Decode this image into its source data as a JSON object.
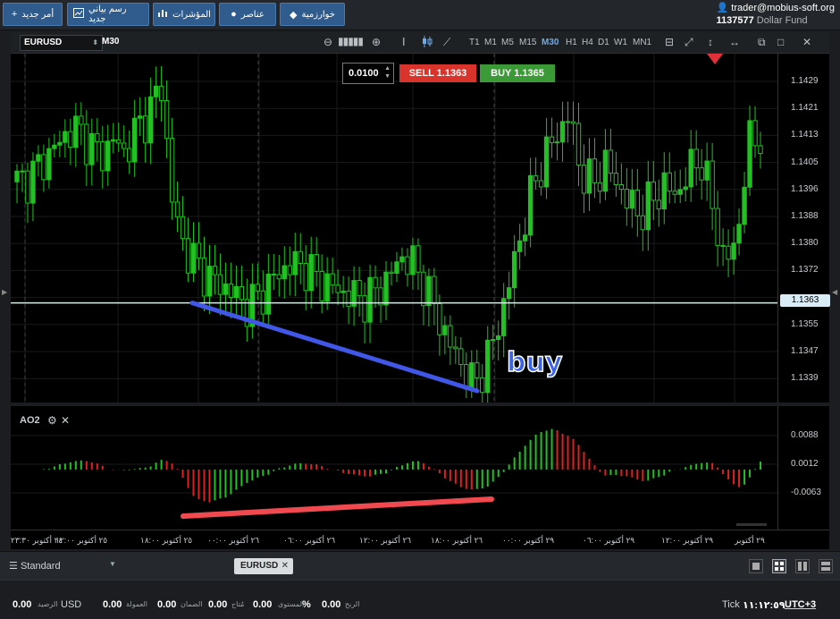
{
  "toolbar": {
    "new_order": "أمر جديد",
    "new_chart": "رسم بياني جديد",
    "indicators": "المؤشرات",
    "elements": "عناصر",
    "algorithms": "خوارزمية"
  },
  "account": {
    "user": "trader@mobius-soft.org",
    "number": "1137577",
    "fund": "Dollar Fund"
  },
  "chart_header": {
    "symbol": "EURUSD",
    "timeframe": "M30",
    "timeframes": [
      "T1",
      "M1",
      "M5",
      "M15",
      "M30",
      "H1",
      "H4",
      "D1",
      "W1",
      "MN1"
    ],
    "active_timeframe": "M30"
  },
  "order_panel": {
    "lot": "0.0100",
    "sell": "SELL 1.1363",
    "buy": "BUY 1.1365"
  },
  "annotation": {
    "buy_text": "buy"
  },
  "price_axis": {
    "labels": [
      "1.1429",
      "1.1421",
      "1.1413",
      "1.1405",
      "1.1396",
      "1.1388",
      "1.1380",
      "1.1372",
      "1.1363",
      "1.1355",
      "1.1347",
      "1.1339"
    ],
    "current_price": "1.1363"
  },
  "indicator": {
    "name": "AO2",
    "axis_labels": [
      "0.0088",
      "0.0012",
      "-0.0063"
    ]
  },
  "time_axis": {
    "labels": [
      "٢٤ أكتوبر ٢٣:٣٠",
      "٢٥ أكتوبر ١٢:٠٠",
      "٢٥ أكتوبر ١٨:٠٠",
      "٢٦ أكتوبر ٠٠:٠٠",
      "٢٦ أكتوبر ٠٦:٠٠",
      "٢٦ أكتوبر ١٢:٠٠",
      "٢٦ أكتوبر ١٨:٠٠",
      "٢٩ أكتوبر ٠٠:٠٠",
      "٢٩ أكتوبر ٠٦:٠٠",
      "٢٩ أكتوبر ١٢:٠٠",
      "٢٩ أكتوبر"
    ]
  },
  "chart_data": {
    "type": "candlestick",
    "symbol": "EURUSD",
    "timeframe": "M30",
    "price_range": [
      1.1335,
      1.1433
    ],
    "close_series": [
      1.1397,
      1.1398,
      1.1402,
      1.1406,
      1.141,
      1.1412,
      1.1408,
      1.1404,
      1.1409,
      1.1405,
      1.1412,
      1.1416,
      1.1425,
      1.139,
      1.1378,
      1.1374,
      1.137,
      1.1368,
      1.1366,
      1.1362,
      1.1364,
      1.1368,
      1.1372,
      1.1374,
      1.1373,
      1.137,
      1.1368,
      1.1366,
      1.1365,
      1.1364,
      1.1366,
      1.137,
      1.1376,
      1.1374,
      1.1368,
      1.136,
      1.1352,
      1.1346,
      1.134,
      1.1345,
      1.1355,
      1.1368,
      1.1382,
      1.1395,
      1.1404,
      1.141,
      1.1416,
      1.14,
      1.1396,
      1.1402,
      1.1397,
      1.1391,
      1.1388,
      1.1392,
      1.1396,
      1.1393,
      1.14,
      1.1404,
      1.139,
      1.1374,
      1.138,
      1.1408,
      1.141
    ],
    "current_price": 1.1363,
    "indicator_range": [
      -0.0085,
      0.01
    ]
  },
  "tabbar": {
    "layout": "Standard",
    "symbol_tab": "EURUSD"
  },
  "status": {
    "balance_label": "الرصيد",
    "balance_value": "0.00",
    "currency": "USD",
    "commission_label": "العمولة",
    "commission_value": "0.00",
    "margin_label": "الضمان",
    "margin_value": "0.00",
    "free_label": "مُتاح",
    "free_value": "0.00",
    "level_label": "المستوى",
    "level_value": "%",
    "profit_label": "الربح",
    "profit_value": "0.00",
    "tick_label": "Tick",
    "time": "١١:١٢:٥٩",
    "timezone": "UTC+3"
  }
}
